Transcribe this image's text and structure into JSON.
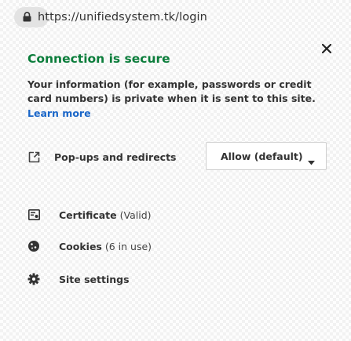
{
  "url": "https://unifiedsystem.tk/login",
  "colors": {
    "secure_green": "#0b7d3b",
    "link_blue": "#1a66c8"
  },
  "panel": {
    "title": "Connection is secure",
    "description": "Your information (for example, passwords or credit card numbers) is private when it is sent to this site.",
    "learn_more": "Learn more",
    "permission": {
      "label": "Pop-ups and redirects",
      "icon": "popup-icon",
      "selected_value": "Allow (default)"
    },
    "certificate": {
      "label": "Certificate",
      "status": "(Valid)",
      "icon": "certificate-icon"
    },
    "cookies": {
      "label": "Cookies",
      "status": "(6 in use)",
      "icon": "cookie-icon"
    },
    "site_settings": {
      "label": "Site settings",
      "icon": "gear-icon"
    }
  }
}
